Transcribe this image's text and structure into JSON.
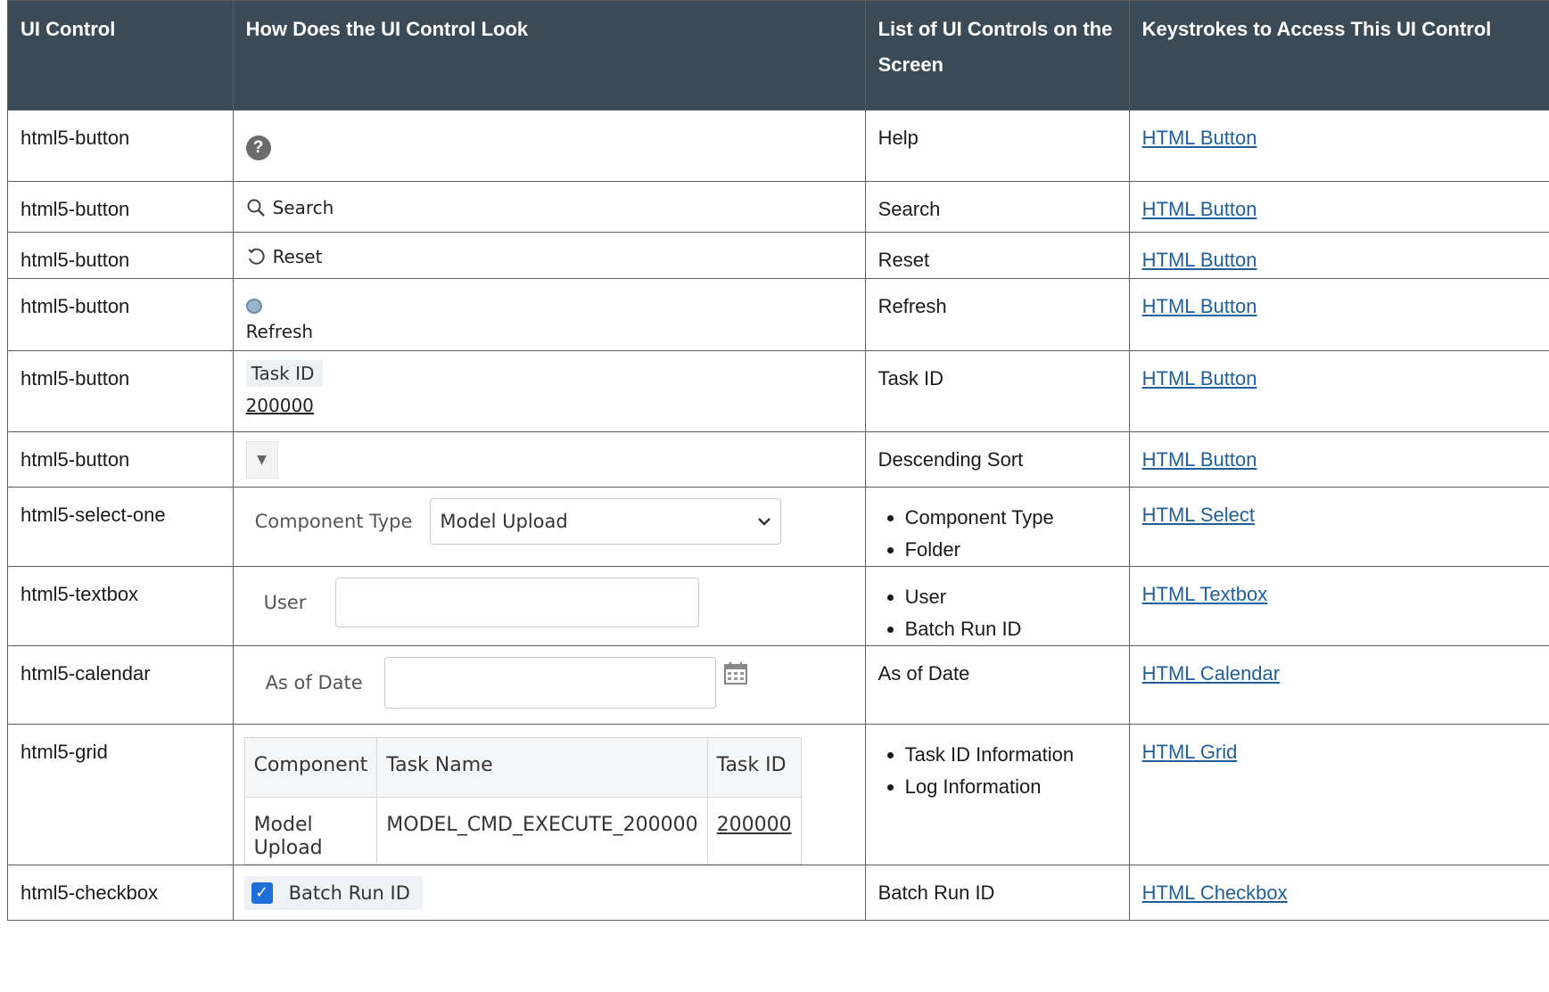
{
  "headers": [
    "UI Control",
    "How Does the UI Control Look",
    "List of UI Controls on the Screen",
    "Keystrokes to Access This UI Control"
  ],
  "rows": [
    {
      "control": "html5-button",
      "list": [
        "Help"
      ],
      "link": "HTML Button"
    },
    {
      "control": "html5-button",
      "list": [
        "Search"
      ],
      "link": "HTML Button"
    },
    {
      "control": "html5-button",
      "list": [
        "Reset"
      ],
      "link": "HTML Button"
    },
    {
      "control": "html5-button",
      "list": [
        "Refresh"
      ],
      "link": "HTML Button"
    },
    {
      "control": "html5-button",
      "list": [
        "Task ID"
      ],
      "link": "HTML Button"
    },
    {
      "control": "html5-button",
      "list": [
        "Descending Sort"
      ],
      "link": "HTML Button"
    },
    {
      "control": "html5-select-one",
      "list": [
        "Component Type",
        "Folder"
      ],
      "link": "HTML Select"
    },
    {
      "control": "html5-textbox",
      "list": [
        "User",
        "Batch Run ID"
      ],
      "link": "HTML Textbox"
    },
    {
      "control": "html5-calendar",
      "list": [
        "As of Date"
      ],
      "link": "HTML Calendar"
    },
    {
      "control": "html5-grid",
      "list": [
        "Task ID Information",
        "Log Information"
      ],
      "link": "HTML Grid"
    },
    {
      "control": "html5-checkbox",
      "list": [
        "Batch Run ID"
      ],
      "link": "HTML Checkbox"
    }
  ],
  "samples": {
    "help_glyph": "?",
    "search_label": "Search",
    "reset_label": "Reset",
    "refresh_label": "Refresh",
    "taskid_header": "Task ID",
    "taskid_value": "200000",
    "sort_glyph": "▼",
    "select_label": "Component Type",
    "select_value": "Model Upload",
    "textbox_label": "User",
    "calendar_label": "As of Date",
    "grid": {
      "headers": [
        "Component",
        "Task Name",
        "Task ID"
      ],
      "row": [
        "Model Upload",
        "MODEL_CMD_EXECUTE_200000",
        "200000"
      ]
    },
    "checkbox_label": "Batch Run ID"
  },
  "colors": {
    "header_bg": "#3a4a56",
    "link": "#1f5f9c",
    "checkbox": "#1e6fd9"
  }
}
